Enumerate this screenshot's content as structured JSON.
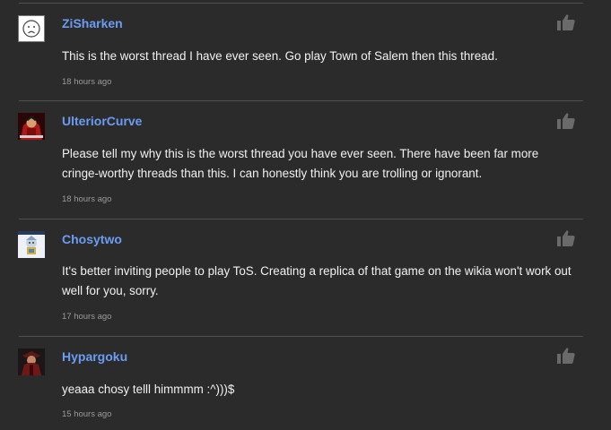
{
  "comments": [
    {
      "username": "ZiSharken",
      "text": "This is the worst thread I have ever seen. Go play Town of Salem then this thread.",
      "time": "18 hours ago",
      "avatar_icon": "sad-face-avatar-icon"
    },
    {
      "username": "UlteriorCurve",
      "text": "Please tell my why this is the worst thread you have ever seen. There have been far more cringe-worthy threads than this. I can honestly think you are trolling or ignorant.",
      "time": "18 hours ago",
      "avatar_icon": "red-character-avatar-icon"
    },
    {
      "username": "Chosytwo",
      "text": "It's better inviting people to play ToS. Creating a replica of that game on the wikia won't work out well for you, sorry.",
      "time": "17 hours ago",
      "avatar_icon": "sprite-character-avatar-icon"
    },
    {
      "username": "Hypargoku",
      "text": "yeaaa chosy telll himmmm :^)))$",
      "time": "15 hours ago",
      "avatar_icon": "dark-character-avatar-icon"
    }
  ],
  "like_icon": "thumbs-up-icon",
  "colors": {
    "background": "#2b2b2b",
    "username": "#6b9cf4",
    "text": "#f1f1f1",
    "timestamp": "#9a9a9a",
    "divider": "#505050",
    "like_icon": "#6a6a6a"
  }
}
